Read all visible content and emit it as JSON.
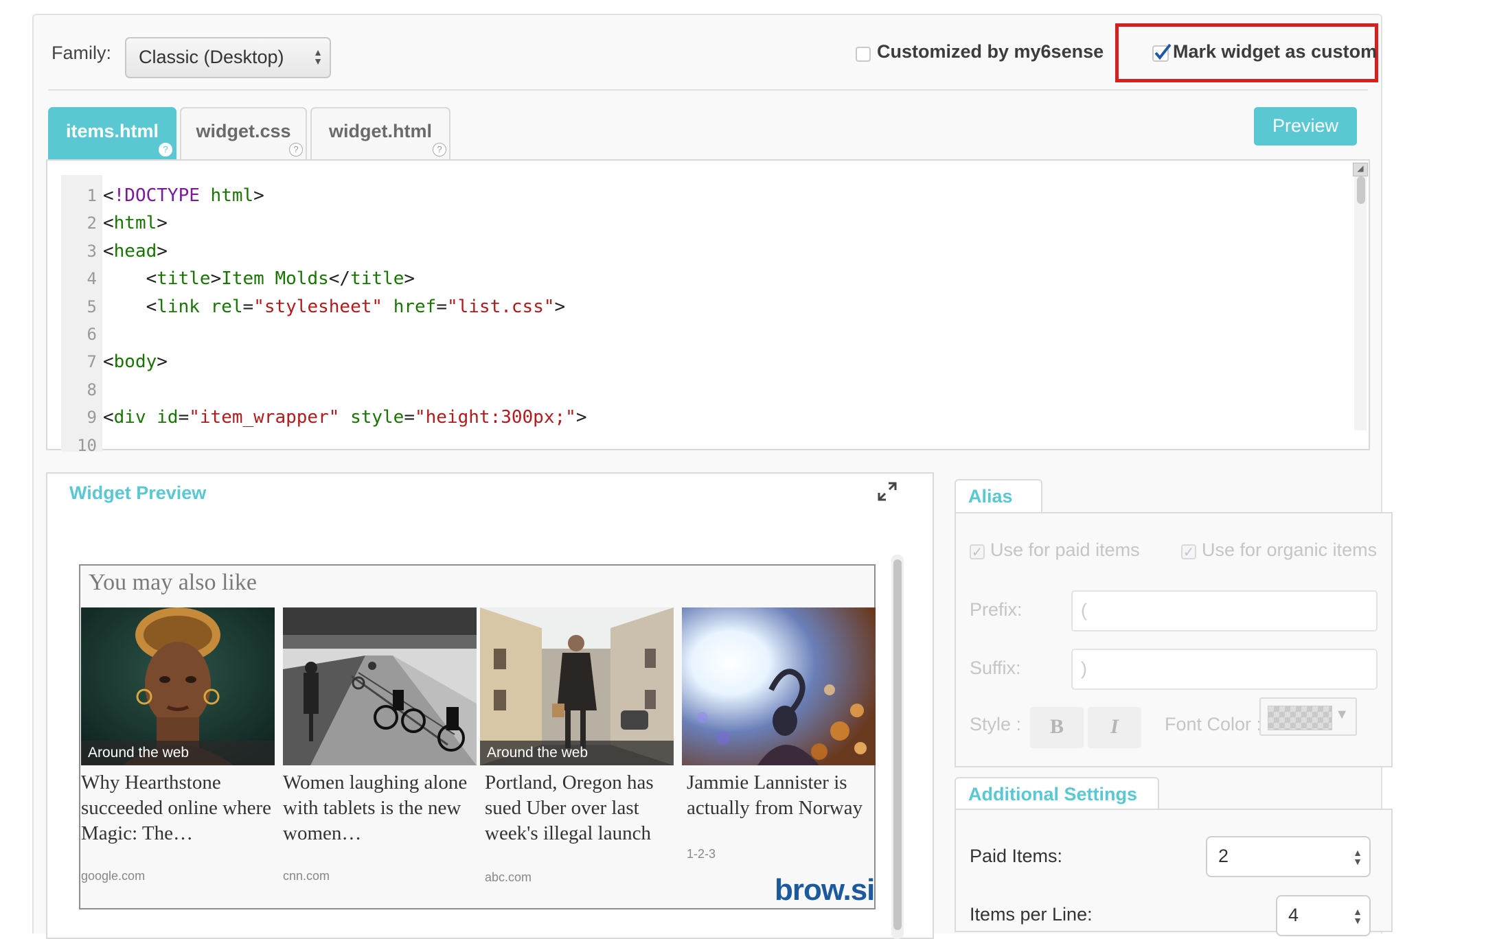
{
  "top_bar": {
    "family_label": "Family:",
    "family_value": "Classic (Desktop)",
    "customized_label": "Customized by my6sense",
    "customized_checked": false,
    "mark_custom_label": "Mark widget as custom",
    "mark_custom_checked": true,
    "highlight_color": "#d6201f"
  },
  "tabs": [
    {
      "label": "items.html",
      "active": true
    },
    {
      "label": "widget.css",
      "active": false
    },
    {
      "label": "widget.html",
      "active": false
    }
  ],
  "preview_button": "Preview",
  "accent_color": "#5ac8d2",
  "code": {
    "lines": [
      {
        "n": "1",
        "tokens": [
          [
            "pun",
            "<"
          ],
          [
            "doc",
            "!DOCTYPE"
          ],
          [
            "pun",
            " "
          ],
          [
            "tag",
            "html"
          ],
          [
            "pun",
            ">"
          ]
        ]
      },
      {
        "n": "2",
        "tokens": [
          [
            "pun",
            "<"
          ],
          [
            "tag",
            "html"
          ],
          [
            "pun",
            ">"
          ]
        ]
      },
      {
        "n": "3",
        "tokens": [
          [
            "pun",
            "<"
          ],
          [
            "tag",
            "head"
          ],
          [
            "pun",
            ">"
          ]
        ]
      },
      {
        "n": "4",
        "tokens": [
          [
            "pun",
            "    <"
          ],
          [
            "tag",
            "title"
          ],
          [
            "pun",
            ">"
          ],
          [
            "txt",
            "Item Molds"
          ],
          [
            "pun",
            "</"
          ],
          [
            "tag",
            "title"
          ],
          [
            "pun",
            ">"
          ]
        ]
      },
      {
        "n": "5",
        "tokens": [
          [
            "pun",
            "    <"
          ],
          [
            "tag",
            "link"
          ],
          [
            "pun",
            " "
          ],
          [
            "atr",
            "rel"
          ],
          [
            "pun",
            "="
          ],
          [
            "str",
            "\"stylesheet\""
          ],
          [
            "pun",
            " "
          ],
          [
            "atr",
            "href"
          ],
          [
            "pun",
            "="
          ],
          [
            "str",
            "\"list.css\""
          ],
          [
            "pun",
            ">"
          ]
        ]
      },
      {
        "n": "6",
        "tokens": []
      },
      {
        "n": "7",
        "tokens": [
          [
            "pun",
            "<"
          ],
          [
            "tag",
            "body"
          ],
          [
            "pun",
            ">"
          ]
        ]
      },
      {
        "n": "8",
        "tokens": []
      },
      {
        "n": "9",
        "tokens": [
          [
            "pun",
            "<"
          ],
          [
            "tag",
            "div"
          ],
          [
            "pun",
            " "
          ],
          [
            "atr",
            "id"
          ],
          [
            "pun",
            "="
          ],
          [
            "str",
            "\"item_wrapper\""
          ],
          [
            "pun",
            " "
          ],
          [
            "atr",
            "style"
          ],
          [
            "pun",
            "="
          ],
          [
            "str",
            "\"height:300px;\""
          ],
          [
            "pun",
            ">"
          ]
        ]
      },
      {
        "n": "10",
        "tokens": []
      }
    ]
  },
  "widget_preview": {
    "title": "Widget Preview",
    "heading": "You may also like",
    "brand": "brow.si",
    "cards": [
      {
        "title": "Why Hearthstone succeeded online where Magic: The…",
        "source": "google.com",
        "overlay": "Around the web"
      },
      {
        "title": "Women laughing alone with tablets is the new women…",
        "source": "cnn.com",
        "overlay": ""
      },
      {
        "title": "Portland, Oregon has sued Uber over last week's illegal launch",
        "source": "abc.com",
        "overlay": "Around the web"
      },
      {
        "title": "Jammie Lannister is actually from Norway",
        "source": "1-2-3",
        "overlay": ""
      }
    ]
  },
  "alias": {
    "tab": "Alias",
    "paid_label": "Use for paid items",
    "paid_checked": true,
    "organic_label": "Use for organic items",
    "organic_checked": true,
    "prefix_label": "Prefix:",
    "prefix_value": "(",
    "suffix_label": "Suffix:",
    "suffix_value": ")",
    "style_label": "Style :",
    "bold": "B",
    "italic": "I",
    "font_color_label": "Font Color :"
  },
  "additional": {
    "tab": "Additional Settings",
    "paid_items_label": "Paid Items:",
    "paid_items_value": "2",
    "items_per_line_label": "Items per Line:",
    "items_per_line_value": "4"
  }
}
